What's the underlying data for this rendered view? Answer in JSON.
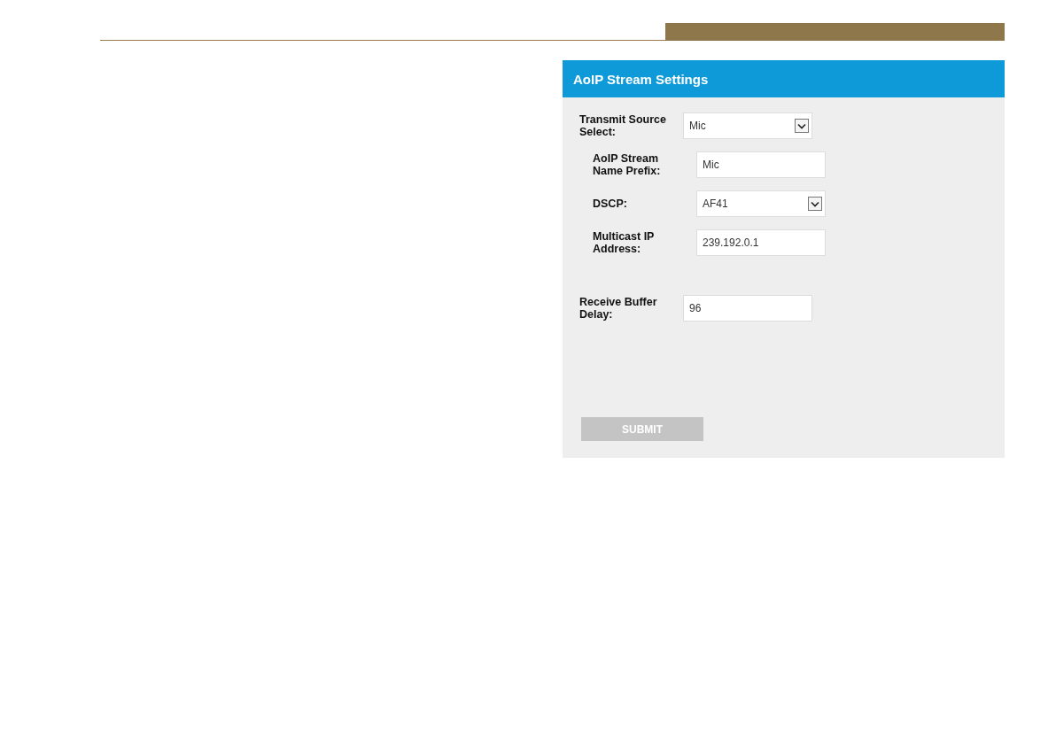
{
  "panel": {
    "title": "AoIP Stream Settings",
    "fields": [
      {
        "kind": "select",
        "label": "Transmit Source Select:",
        "value": "Mic",
        "children": [
          {
            "kind": "text",
            "label": "AoIP Stream Name Prefix:",
            "value": "Mic"
          },
          {
            "kind": "select",
            "label": "DSCP:",
            "value": "AF41"
          },
          {
            "kind": "text",
            "label": "Multicast IP Address:",
            "value": "239.192.0.1"
          }
        ]
      },
      {
        "kind": "text",
        "label": "Receive Buffer Delay:",
        "value": "96"
      }
    ],
    "submit": {
      "label": "SUBMIT",
      "disabled": true
    }
  }
}
